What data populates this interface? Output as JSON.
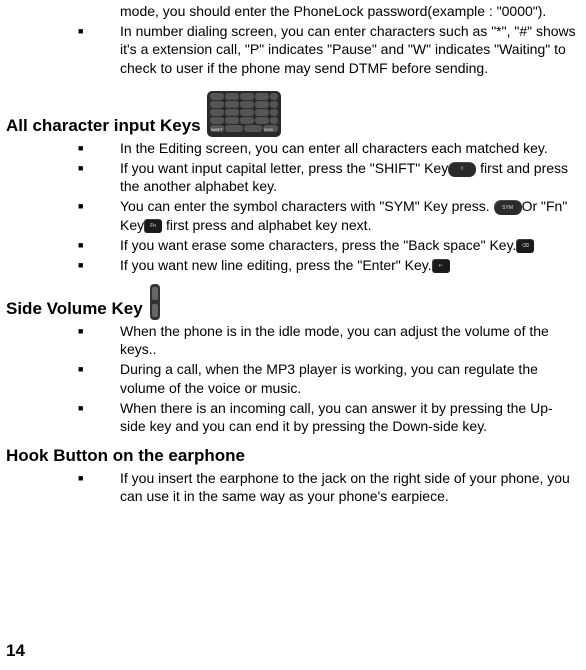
{
  "pageNumber": "14",
  "intro": {
    "bullets": [
      "mode, you should enter the PhoneLock password(example : \"0000\").",
      "In number dialing screen, you can enter characters such as \"*\", \"#\" shows it's a extension call, \"P\" indicates \"Pause\" and \"W\" indicates \"Waiting\" to check to user if the phone may send DTMF before sending."
    ]
  },
  "sections": {
    "charInput": {
      "title": "All character input Keys",
      "bullets": [
        {
          "pre": "In the Editing screen, you can enter all characters each matched key."
        },
        {
          "pre": "If you want input capital letter, press the \"SHIFT\" Key",
          "icon": "shift-key-icon",
          "post": " first and press the another alphabet key."
        },
        {
          "pre": "You can enter the symbol characters with \"SYM\" Key press. ",
          "icon": "sym-key-icon",
          "mid": "Or \"Fn\" Key",
          "icon2": "fn-key-icon",
          "post": " first press and alphabet key next."
        },
        {
          "pre": "If you want erase some characters, press the \"Back space\" Key.",
          "icon": "back-key-icon"
        },
        {
          "pre": "If you want new line editing, press the \"Enter\" Key.",
          "icon": "enter-key-icon"
        }
      ]
    },
    "sideVolume": {
      "title": "Side Volume Key",
      "bullets": [
        "When the phone is in the idle mode, you can adjust the volume of the keys..",
        "During a call, when the MP3 player is working, you can regulate the volume of the voice or music.",
        "When there is an incoming call, you can answer it by pressing the Up-side key and you can end it by pressing the Down-side key."
      ]
    },
    "hookButton": {
      "title": "Hook Button on the earphone",
      "bullets": [
        "If you insert the earphone to the jack on the right side of your phone, you can use it in the same way as your phone's earpiece."
      ]
    }
  }
}
